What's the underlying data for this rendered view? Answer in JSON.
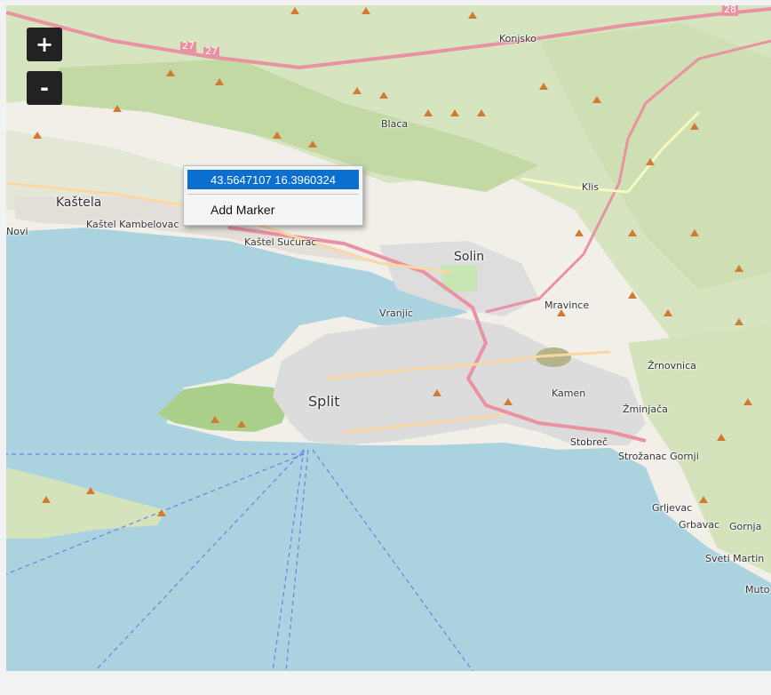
{
  "zoom": {
    "in_label": "+",
    "out_label": "-"
  },
  "context_menu": {
    "coordinates": "43.5647107 16.3960324",
    "add_marker_label": "Add Marker"
  },
  "map": {
    "labels": {
      "konjsko": "Konjsko",
      "blaca": "Blaca",
      "klis": "Klis",
      "kastela": "Kaštela",
      "novi": "Novi",
      "kastel_kambelovac": "Kaštel Kambelovac",
      "kastel_sucurac": "Kaštel Sućurac",
      "solin": "Solin",
      "vranjic": "Vranjic",
      "mravince": "Mravince",
      "split": "Split",
      "kamen": "Kamen",
      "zrnovnica": "Žrnovnica",
      "zminjaca": "Žminjača",
      "stobrec": "Stobreč",
      "strozanac": "Strožanac Gornji",
      "grljevac": "Grljevac",
      "grbavac": "Grbavac",
      "gornja": "Gornja",
      "sveti_martin": "Sveti Martin",
      "muto": "Muto"
    },
    "road_shields": {
      "r27a": "27",
      "r27b": "27",
      "r28": "28"
    },
    "colors": {
      "sea": "#aad3df",
      "land": "#f2efe9",
      "forest": "#c8dcaa",
      "urban": "#d9d9d9",
      "highway": "#e892a2",
      "primary": "#fcd6a4",
      "peak": "#d27a33",
      "accent": "#0a6fd1"
    }
  }
}
